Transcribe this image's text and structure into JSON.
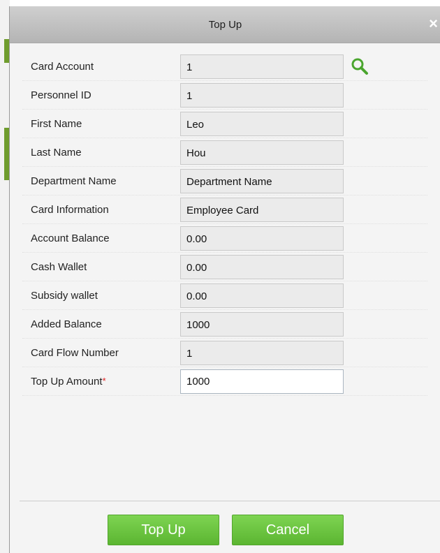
{
  "dialog": {
    "title": "Top Up",
    "close_symbol": "×"
  },
  "fields": [
    {
      "label": "Card Account",
      "value": "1"
    },
    {
      "label": "Personnel ID",
      "value": "1"
    },
    {
      "label": "First Name",
      "value": "Leo"
    },
    {
      "label": "Last Name",
      "value": "Hou"
    },
    {
      "label": "Department Name",
      "value": "Department Name"
    },
    {
      "label": "Card Information",
      "value": "Employee Card"
    },
    {
      "label": "Account Balance",
      "value": "0.00"
    },
    {
      "label": "Cash Wallet",
      "value": "0.00"
    },
    {
      "label": "Subsidy wallet",
      "value": "0.00"
    },
    {
      "label": "Added Balance",
      "value": "1000"
    },
    {
      "label": "Card Flow Number",
      "value": "1"
    }
  ],
  "topup": {
    "label": "Top Up Amount",
    "required_mark": "*",
    "value": "1000"
  },
  "buttons": {
    "confirm": "Top Up",
    "cancel": "Cancel"
  },
  "icons": {
    "search": "search-icon",
    "close": "close-icon"
  },
  "colors": {
    "accent_green": "#6cc23f",
    "required_red": "#e02020",
    "search_icon": "#4aa52e"
  }
}
